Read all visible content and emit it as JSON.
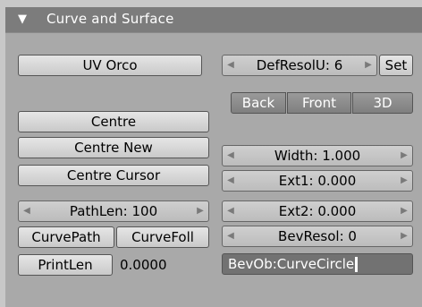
{
  "header": {
    "collapse_glyph": "▼",
    "title": "Curve and Surface"
  },
  "left": {
    "uv_orco": "UV Orco",
    "centre": "Centre",
    "centre_new": "Centre New",
    "centre_cursor": "Centre Cursor",
    "pathlen": "PathLen: 100",
    "curvepath": "CurvePath",
    "curvefoll": "CurveFoll",
    "printlen": "PrintLen",
    "printlen_value": "0.0000"
  },
  "right": {
    "defresolu": "DefResolU: 6",
    "set": "Set",
    "back": "Back",
    "front": "Front",
    "three_d": "3D",
    "width": "Width: 1.000",
    "ext1": "Ext1: 0.000",
    "ext2": "Ext2: 0.000",
    "bevresol": "BevResol: 0",
    "bevob": "BevOb:CurveCircle"
  },
  "icons": {
    "arrow_left": "◀",
    "arrow_right": "▶"
  }
}
